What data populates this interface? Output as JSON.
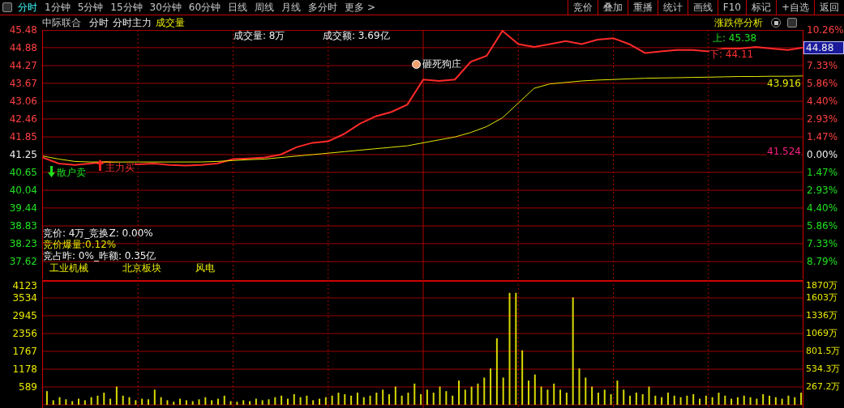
{
  "toolbar": {
    "tabs": [
      {
        "label": "分时",
        "selected": true
      },
      {
        "label": "1分钟",
        "selected": false
      },
      {
        "label": "5分钟",
        "selected": false
      },
      {
        "label": "15分钟",
        "selected": false
      },
      {
        "label": "30分钟",
        "selected": false
      },
      {
        "label": "60分钟",
        "selected": false
      },
      {
        "label": "日线",
        "selected": false
      },
      {
        "label": "周线",
        "selected": false
      },
      {
        "label": "月线",
        "selected": false
      },
      {
        "label": "多分时",
        "selected": false
      },
      {
        "label": "更多 >",
        "selected": false
      }
    ],
    "buttons": [
      "竞价",
      "叠加",
      "重播",
      "统计",
      "画线",
      "F10",
      "标记",
      "+自选",
      "返回"
    ]
  },
  "header": {
    "stock_name": "中际联合",
    "indicators": [
      {
        "label": "分时",
        "active": false
      },
      {
        "label": "分时主力",
        "active": false
      },
      {
        "label": "成交量",
        "active": true
      }
    ],
    "analysis_link": "涨跌停分析"
  },
  "price_chart": {
    "info": [
      "成交量: 8万",
      "成交额: 3.69亿"
    ],
    "markers": [
      {
        "kind": "high",
        "label": "上: 45.38"
      },
      {
        "kind": "low",
        "label": "下: 44.11"
      },
      {
        "kind": "note",
        "label": "砸死狗庄"
      },
      {
        "kind": "sell",
        "label": "散户卖"
      },
      {
        "kind": "buy",
        "label": "主力买"
      },
      {
        "kind": "avg_end",
        "label": "43.916"
      },
      {
        "kind": "base_avg",
        "label": "41.524"
      }
    ],
    "auction_info": [
      {
        "label": "竞价: 4万_竞换Z: 0.00%",
        "highlight": false
      },
      {
        "label": "竞价爆量:0.12%",
        "highlight": true
      },
      {
        "label": "竞占昨: 0%_昨额: 0.35亿",
        "highlight": false
      }
    ],
    "sectors": [
      "工业机械",
      "北京板块",
      "风电"
    ],
    "percent_axis": [
      {
        "kind": "percent",
        "label": "10.26%",
        "color": "#ff4040"
      },
      {
        "kind": "badge",
        "label": "44.88"
      },
      {
        "kind": "percent",
        "label": "7.33%",
        "color": "#ff4040"
      },
      {
        "kind": "percent",
        "label": "5.86%",
        "color": "#ff4040"
      },
      {
        "kind": "percent",
        "label": "4.40%",
        "color": "#ff4040"
      },
      {
        "kind": "percent",
        "label": "2.93%",
        "color": "#ff4040"
      },
      {
        "kind": "percent",
        "label": "1.47%",
        "color": "#ff4040"
      },
      {
        "kind": "percent",
        "label": "0.00%",
        "color": "#f0f0f0"
      },
      {
        "kind": "percent",
        "label": "1.47%",
        "color": "#20e020"
      },
      {
        "kind": "percent",
        "label": "2.93%",
        "color": "#20e020"
      },
      {
        "kind": "percent",
        "label": "4.40%",
        "color": "#20e020"
      },
      {
        "kind": "percent",
        "label": "5.86%",
        "color": "#20e020"
      },
      {
        "kind": "percent",
        "label": "7.33%",
        "color": "#20e020"
      },
      {
        "kind": "percent",
        "label": "8.79%",
        "color": "#20e020"
      }
    ],
    "chart_data": {
      "type": "line",
      "grid": true,
      "categories": [
        null,
        null,
        null,
        null,
        null,
        null,
        null,
        null,
        null,
        null,
        null,
        null,
        null,
        null,
        null,
        null,
        null,
        null,
        null,
        null,
        null,
        null,
        null,
        null,
        null,
        null,
        null,
        null,
        null,
        null,
        null,
        null,
        null,
        null,
        null,
        null,
        null,
        null,
        null,
        null,
        null,
        null,
        null,
        null,
        null,
        null,
        null,
        null,
        null
      ],
      "series": [
        {
          "color": "#ff2a2a",
          "values": [
            41.15,
            40.95,
            40.9,
            40.95,
            41.0,
            40.95,
            40.92,
            40.95,
            40.9,
            40.88,
            40.9,
            40.95,
            41.1,
            41.12,
            41.15,
            41.25,
            41.5,
            41.65,
            41.7,
            41.95,
            42.3,
            42.55,
            42.7,
            42.95,
            43.8,
            43.75,
            43.8,
            44.4,
            44.6,
            45.45,
            45.0,
            44.9,
            45.0,
            45.1,
            45.0,
            45.15,
            45.2,
            45.0,
            44.7,
            44.75,
            44.8,
            44.8,
            44.75,
            44.85,
            44.85,
            44.9,
            44.85,
            44.8,
            44.88
          ]
        },
        {
          "color": "#e8e800",
          "values": [
            41.2,
            41.1,
            41.02,
            41.0,
            41.0,
            41.0,
            41.0,
            41.0,
            41.0,
            41.0,
            41.0,
            41.02,
            41.05,
            41.08,
            41.1,
            41.15,
            41.2,
            41.25,
            41.3,
            41.35,
            41.4,
            41.45,
            41.5,
            41.55,
            41.65,
            41.75,
            41.85,
            42.0,
            42.2,
            42.5,
            43.0,
            43.5,
            43.65,
            43.7,
            43.75,
            43.78,
            43.8,
            43.82,
            43.84,
            43.85,
            43.86,
            43.87,
            43.88,
            43.89,
            43.9,
            43.9,
            43.91,
            43.91,
            43.92
          ]
        }
      ],
      "ylim": [
        37.02,
        45.48
      ],
      "yticks": [
        {
          "value": 45.48,
          "label": "45.48"
        },
        {
          "value": 44.88,
          "label": "44.88"
        },
        {
          "value": 44.27,
          "label": "44.27"
        },
        {
          "value": 43.67,
          "label": "43.67"
        },
        {
          "value": 43.06,
          "label": "43.06"
        },
        {
          "value": 42.46,
          "label": "42.46"
        },
        {
          "value": 41.85,
          "label": "41.85"
        },
        {
          "value": 41.25,
          "label": "41.25"
        },
        {
          "value": 40.65,
          "label": "40.65"
        },
        {
          "value": 40.04,
          "label": "40.04"
        },
        {
          "value": 39.44,
          "label": "39.44"
        },
        {
          "value": 38.83,
          "label": "38.83"
        },
        {
          "value": 38.23,
          "label": "38.23"
        },
        {
          "value": 37.62,
          "label": "37.62"
        }
      ]
    }
  },
  "volume_chart": {
    "amount_axis": [
      "1870万",
      "1603万",
      "1336万",
      "1069万",
      "801.5万",
      "534.3万",
      "267.2万"
    ],
    "chart_data": {
      "type": "bar",
      "grid": true,
      "ylim": [
        0,
        4123
      ],
      "yticks": [
        {
          "value": 4123,
          "label": "4123"
        },
        {
          "value": 3534,
          "label": "3534"
        },
        {
          "value": 2945,
          "label": "2945"
        },
        {
          "value": 2356,
          "label": "2356"
        },
        {
          "value": 1767,
          "label": "1767"
        },
        {
          "value": 1178,
          "label": "1178"
        },
        {
          "value": 589,
          "label": "589"
        }
      ],
      "series": [
        {
          "color": "#d8d800",
          "values": [
            450,
            150,
            250,
            180,
            120,
            200,
            150,
            250,
            300,
            400,
            200,
            600,
            300,
            250,
            150,
            200,
            180,
            500,
            250,
            150,
            100,
            200,
            150,
            120,
            180,
            250,
            150,
            200,
            300,
            120,
            100,
            150,
            120,
            200,
            150,
            180,
            250,
            300,
            200,
            350,
            250,
            300,
            150,
            200,
            250,
            300,
            400,
            350,
            300,
            400,
            250,
            300,
            400,
            500,
            350,
            600,
            300,
            400,
            700,
            350,
            500,
            400,
            600,
            450,
            300,
            800,
            500,
            600,
            700,
            900,
            1200,
            2200,
            900,
            3700,
            3700,
            1800,
            800,
            1000,
            600,
            500,
            700,
            500,
            400,
            3550,
            1200,
            900,
            600,
            400,
            500,
            350,
            800,
            500,
            300,
            400,
            350,
            600,
            300,
            250,
            400,
            300,
            250,
            300,
            350,
            200,
            300,
            250,
            400,
            300,
            200,
            250,
            300,
            250,
            200,
            350,
            300,
            250,
            200,
            300,
            250,
            400
          ]
        }
      ]
    }
  }
}
